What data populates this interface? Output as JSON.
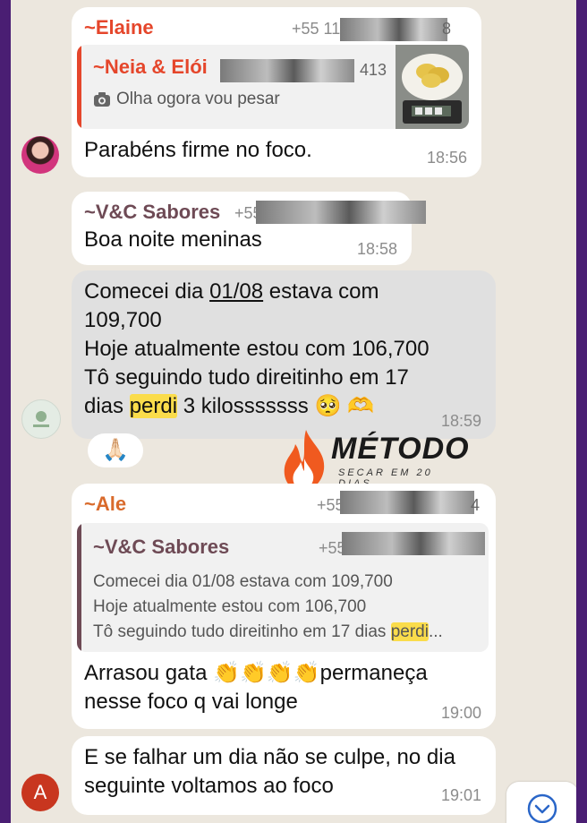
{
  "messages": [
    {
      "sender": "~Elaine",
      "phone": "+55 11",
      "phone_end": "8",
      "quote": {
        "sender": "~Neia & Elói",
        "phone_end": "413",
        "text": "Olha ogora vou pesar",
        "icon": "camera-icon"
      },
      "text": "Parabéns firme no foco.",
      "time": "18:56"
    },
    {
      "sender": "~V&C Sabores",
      "phone": "+55 2",
      "text": "Boa noite meninas",
      "time": "18:58"
    },
    {
      "line1": "Comecei dia ",
      "line1_date": "01/08",
      "line1_end": " estava com",
      "line2": "109,700",
      "line3": "Hoje atualmente estou com 106,700",
      "line4": "Tô seguindo tudo direitinho em 17",
      "line5_start": "dias ",
      "line5_hl": "perdi",
      "line5_end": " 3 kilosssssss 🥺 🫶",
      "time": "18:59",
      "reaction": "🙏🏻"
    },
    {
      "sender": "~Ale",
      "phone": "+55 2",
      "phone_end": "4",
      "quote": {
        "sender": "~V&C Sabores",
        "phone": "+55 2",
        "line1": "Comecei dia 01/08 estava com 109,700",
        "line2": "Hoje atualmente estou com 106,700",
        "line3_start": "Tô seguindo tudo direitinho em 17 dias ",
        "line3_hl": "perdi",
        "line3_end": "..."
      },
      "line1": "Arrasou gata 👏👏👏👏permaneça",
      "line2": "nesse foco q vai longe",
      "time": "19:00"
    },
    {
      "line1": "E se falhar um dia não se culpe, no dia",
      "line2": "seguinte voltamos ao foco",
      "time": "19:01"
    }
  ],
  "avatars": {
    "ale_initial": "A"
  },
  "watermark": {
    "title": "MÉTODO",
    "subtitle": "SECAR EM 20 DIAS"
  },
  "colors": {
    "background": "#ece7de",
    "frame": "#4a1e73",
    "highlight": "#fadc4b",
    "sender_red": "#e5462b"
  }
}
